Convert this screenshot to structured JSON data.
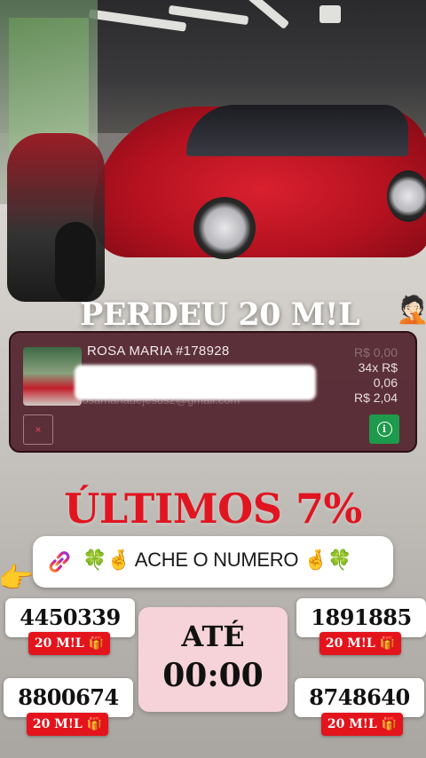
{
  "headline": {
    "text": "PERDEU 20 M!L",
    "emoji": "🤦🏻"
  },
  "winner_card": {
    "name": "ROSA MARIA #178928",
    "email_hidden": "rosamariadejesus2@gmail.com",
    "price_lines": [
      "R$ 0,00",
      "34x R$",
      "0,06",
      "R$ 2,04"
    ],
    "close_symbol": "×",
    "info_symbol": "i"
  },
  "progress": {
    "text": "ÚLTIMOS 7%",
    "percent_remaining": 7
  },
  "search_bar": {
    "link_icon": "link-icon",
    "left_emojis": "🍀🤞",
    "label": "ACHE O NUMERO",
    "right_emojis": "🤞🍀",
    "pointer_emoji": "👉"
  },
  "numbers": [
    {
      "value": "4450339",
      "prize": "20 M!L 🎁"
    },
    {
      "value": "1891885",
      "prize": "20 M!L 🎁"
    },
    {
      "value": "8800674",
      "prize": "20 M!L 🎁"
    },
    {
      "value": "8748640",
      "prize": "20 M!L 🎁"
    }
  ],
  "timer": {
    "label": "ATÉ",
    "value": "00:00"
  },
  "colors": {
    "accent_red": "#e01520",
    "card_bg": "#481622",
    "info_green": "#1d9a4b",
    "timer_bg": "#f6d3d8"
  }
}
